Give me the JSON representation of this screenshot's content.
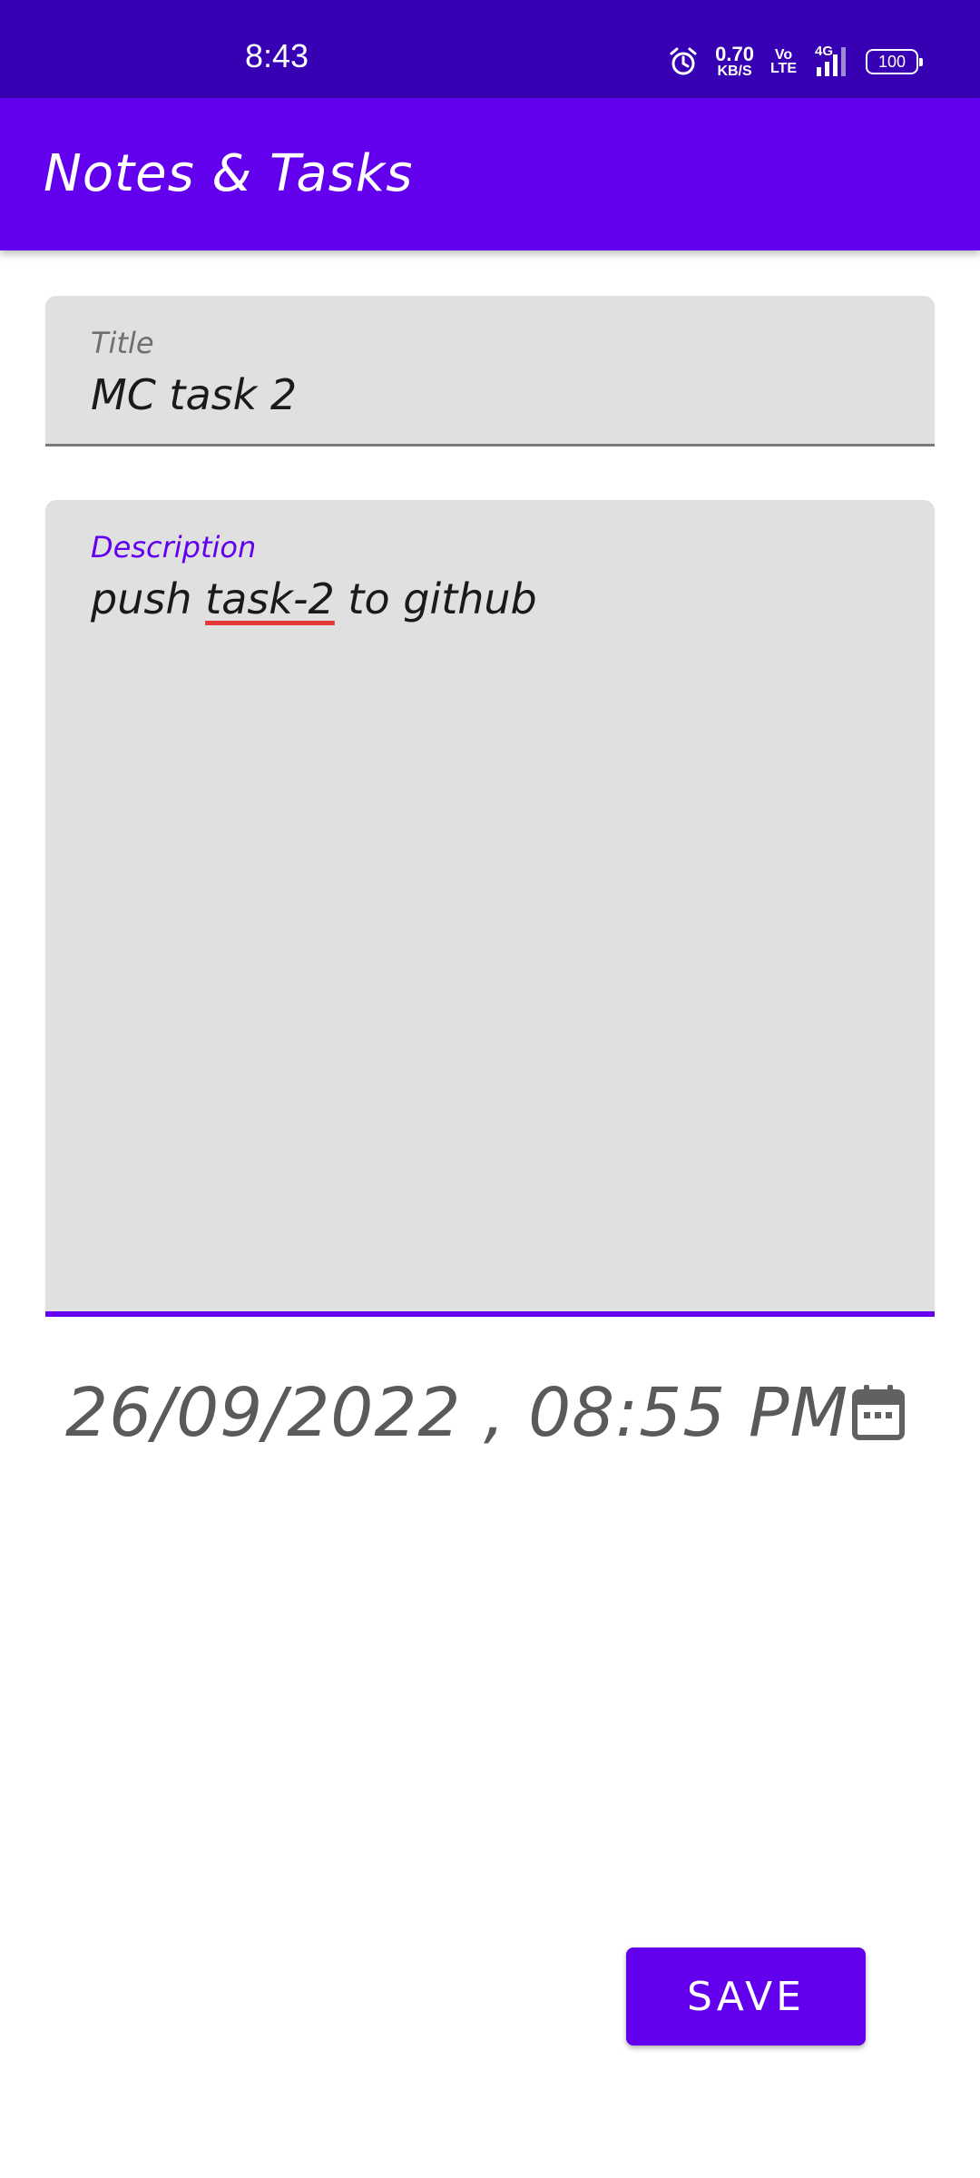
{
  "status_bar": {
    "time": "8:43",
    "speed_value": "0.70",
    "speed_unit": "KB/S",
    "volte_top": "Vo",
    "volte_bottom": "LTE",
    "network": "4G",
    "battery": "100"
  },
  "app_bar": {
    "title": "Notes & Tasks"
  },
  "form": {
    "title_label": "Title",
    "title_value": "MC task 2",
    "description_label": "Description",
    "description_prefix": "push ",
    "description_misspelled": "task-2",
    "description_suffix": " to github",
    "datetime": "26/09/2022 , 08:55 PM",
    "calendar_icon": "calendar-icon",
    "save_label": "SAVE"
  },
  "colors": {
    "status_bar": "#3700b3",
    "primary": "#6200ee",
    "field_bg": "#e0e0e0",
    "spell_error": "#e53935"
  }
}
